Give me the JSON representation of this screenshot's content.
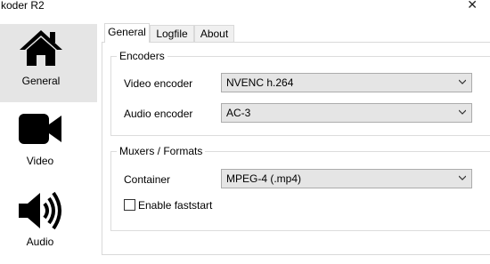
{
  "window": {
    "title": "koder R2"
  },
  "sidebar": {
    "items": [
      {
        "label": "General",
        "icon": "home-icon"
      },
      {
        "label": "Video",
        "icon": "video-camera-icon"
      },
      {
        "label": "Audio",
        "icon": "speaker-icon"
      }
    ]
  },
  "tabs": [
    {
      "label": "General"
    },
    {
      "label": "Logfile"
    },
    {
      "label": "About"
    }
  ],
  "encoders": {
    "title": "Encoders",
    "video_label": "Video encoder",
    "video_value": "NVENC h.264",
    "audio_label": "Audio encoder",
    "audio_value": "AC-3"
  },
  "muxers": {
    "title": "Muxers / Formats",
    "container_label": "Container",
    "container_value": "MPEG-4 (.mp4)",
    "faststart_label": "Enable faststart"
  },
  "colors": {
    "selected_item_bg": "#e5e5e5",
    "icon": "#000000"
  }
}
